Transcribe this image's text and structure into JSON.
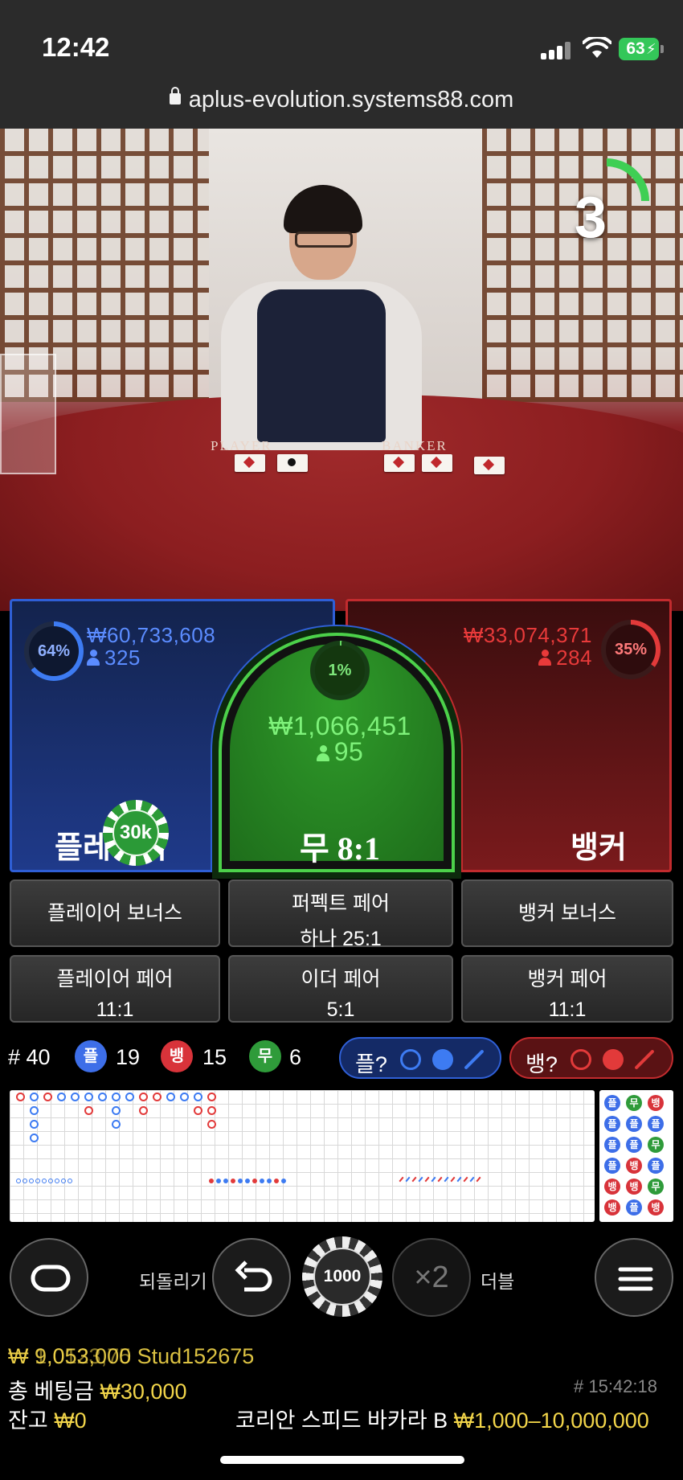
{
  "status_bar": {
    "time": "12:42",
    "battery": "63",
    "url": "aplus-evolution.systems88.com"
  },
  "video": {
    "countdown": "3",
    "countdown_fraction": 0.25,
    "table_player_label": "PLAYER",
    "table_banker_label": "BANKER"
  },
  "bets": {
    "player": {
      "percent": "64%",
      "amount": "₩60,733,608",
      "players": "325",
      "label": "플레이어",
      "color": "#2f5fd6"
    },
    "banker": {
      "percent": "35%",
      "amount": "₩33,074,371",
      "players": "284",
      "label": "뱅커",
      "color": "#c22b2e"
    },
    "tie": {
      "percent": "1%",
      "amount": "₩1,066,451",
      "players": "95",
      "label": "무 8:1",
      "color": "#4cd14a"
    },
    "placed_chip": "30k"
  },
  "side_bets": {
    "player_bonus": "플레이어 보너스",
    "perfect_pair_1": "퍼펙트 페어",
    "perfect_pair_2": "하나 25:1",
    "banker_bonus": "뱅커 보너스",
    "player_pair_1": "플레이어 페어",
    "player_pair_2": "11:1",
    "either_pair_1": "이더 페어",
    "either_pair_2": "5:1",
    "banker_pair_1": "뱅커 페어",
    "banker_pair_2": "11:1"
  },
  "stats": {
    "round": "# 40",
    "player_short": "플",
    "player_count": "19",
    "banker_short": "뱅",
    "banker_count": "15",
    "tie_short": "무",
    "tie_count": "6",
    "player_predict": "플?",
    "banker_predict": "뱅?"
  },
  "bead_road": [
    [
      "플",
      "무",
      "뱅"
    ],
    [
      "플",
      "플",
      "플"
    ],
    [
      "플",
      "플",
      "무"
    ],
    [
      "플",
      "뱅",
      "플"
    ],
    [
      "뱅",
      "뱅",
      "무"
    ],
    [
      "뱅",
      "플",
      "뱅"
    ]
  ],
  "controls": {
    "undo_label": "되돌리기",
    "chip_value": "1000",
    "double_symbol": "×2",
    "double_label": "더블"
  },
  "footer": {
    "overlap_line": "₩ 9,053,000 Stud152675",
    "overlap_line_b": "₩ 1,0123,75",
    "total_bet_label": "총 베팅금",
    "total_bet_value": "₩30,000",
    "balance_label": "잔고",
    "balance_value": "₩0",
    "game_id": "# 15:42:18",
    "table_name": "코리안 스피드 바카라 B",
    "limits": "₩1,000–10,000,000"
  }
}
